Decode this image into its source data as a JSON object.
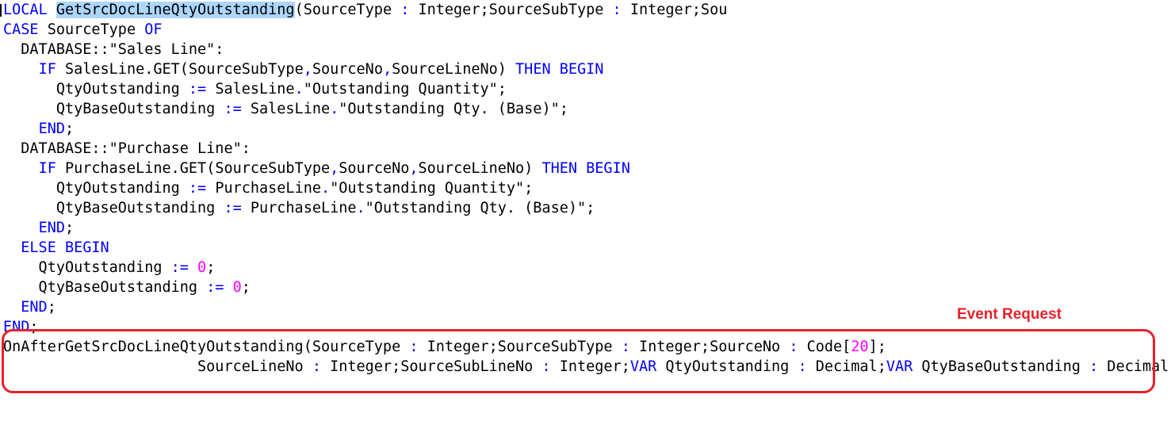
{
  "editor": {
    "lines": [
      {
        "segments": [
          {
            "text": "LOCAL ",
            "cls": "kw"
          },
          {
            "text": "GetSrcDocLineQtyOutstanding",
            "cls": "ident hl"
          },
          {
            "text": "(SourceType ",
            "cls": "ident"
          },
          {
            "text": ":",
            "cls": "op"
          },
          {
            "text": " Integer;SourceSubType ",
            "cls": "ident"
          },
          {
            "text": ":",
            "cls": "op"
          },
          {
            "text": " Integer;Sou",
            "cls": "ident"
          }
        ]
      },
      {
        "segments": [
          {
            "text": "CASE ",
            "cls": "kw"
          },
          {
            "text": "SourceType ",
            "cls": "ident"
          },
          {
            "text": "OF",
            "cls": "kw"
          }
        ]
      },
      {
        "segments": [
          {
            "text": "  DATABASE::\"Sales Line\":",
            "cls": "ident"
          }
        ]
      },
      {
        "segments": [
          {
            "text": "    ",
            "cls": "ident"
          },
          {
            "text": "IF ",
            "cls": "kw"
          },
          {
            "text": "SalesLine.GET(SourceSubType",
            "cls": "ident"
          },
          {
            "text": ",",
            "cls": "op"
          },
          {
            "text": "SourceNo",
            "cls": "ident"
          },
          {
            "text": ",",
            "cls": "op"
          },
          {
            "text": "SourceLineNo) ",
            "cls": "ident"
          },
          {
            "text": "THEN BEGIN",
            "cls": "kw"
          }
        ]
      },
      {
        "segments": [
          {
            "text": "      QtyOutstanding ",
            "cls": "ident"
          },
          {
            "text": ":=",
            "cls": "op"
          },
          {
            "text": " SalesLine",
            "cls": "ident"
          },
          {
            "text": ".",
            "cls": "op"
          },
          {
            "text": "\"Outstanding Quantity\";",
            "cls": "ident"
          }
        ]
      },
      {
        "segments": [
          {
            "text": "      QtyBaseOutstanding ",
            "cls": "ident"
          },
          {
            "text": ":=",
            "cls": "op"
          },
          {
            "text": " SalesLine",
            "cls": "ident"
          },
          {
            "text": ".",
            "cls": "op"
          },
          {
            "text": "\"Outstanding Qty. (Base)\";",
            "cls": "ident"
          }
        ]
      },
      {
        "segments": [
          {
            "text": "    ",
            "cls": "ident"
          },
          {
            "text": "END",
            "cls": "kw"
          },
          {
            "text": ";",
            "cls": "ident"
          }
        ]
      },
      {
        "segments": [
          {
            "text": "  DATABASE::\"Purchase Line\":",
            "cls": "ident"
          }
        ]
      },
      {
        "segments": [
          {
            "text": "    ",
            "cls": "ident"
          },
          {
            "text": "IF ",
            "cls": "kw"
          },
          {
            "text": "PurchaseLine.GET(SourceSubType",
            "cls": "ident"
          },
          {
            "text": ",",
            "cls": "op"
          },
          {
            "text": "SourceNo",
            "cls": "ident"
          },
          {
            "text": ",",
            "cls": "op"
          },
          {
            "text": "SourceLineNo) ",
            "cls": "ident"
          },
          {
            "text": "THEN BEGIN",
            "cls": "kw"
          }
        ]
      },
      {
        "segments": [
          {
            "text": "      QtyOutstanding ",
            "cls": "ident"
          },
          {
            "text": ":=",
            "cls": "op"
          },
          {
            "text": " PurchaseLine",
            "cls": "ident"
          },
          {
            "text": ".",
            "cls": "op"
          },
          {
            "text": "\"Outstanding Quantity\";",
            "cls": "ident"
          }
        ]
      },
      {
        "segments": [
          {
            "text": "      QtyBaseOutstanding ",
            "cls": "ident"
          },
          {
            "text": ":=",
            "cls": "op"
          },
          {
            "text": " PurchaseLine",
            "cls": "ident"
          },
          {
            "text": ".",
            "cls": "op"
          },
          {
            "text": "\"Outstanding Qty. (Base)\";",
            "cls": "ident"
          }
        ]
      },
      {
        "segments": [
          {
            "text": "    ",
            "cls": "ident"
          },
          {
            "text": "END",
            "cls": "kw"
          },
          {
            "text": ";",
            "cls": "ident"
          }
        ]
      },
      {
        "segments": [
          {
            "text": "  ",
            "cls": "ident"
          },
          {
            "text": "ELSE BEGIN",
            "cls": "kw"
          }
        ]
      },
      {
        "segments": [
          {
            "text": "    QtyOutstanding ",
            "cls": "ident"
          },
          {
            "text": ":=",
            "cls": "op"
          },
          {
            "text": " ",
            "cls": "ident"
          },
          {
            "text": "0",
            "cls": "num"
          },
          {
            "text": ";",
            "cls": "ident"
          }
        ]
      },
      {
        "segments": [
          {
            "text": "    QtyBaseOutstanding ",
            "cls": "ident"
          },
          {
            "text": ":=",
            "cls": "op"
          },
          {
            "text": " ",
            "cls": "ident"
          },
          {
            "text": "0",
            "cls": "num"
          },
          {
            "text": ";",
            "cls": "ident"
          }
        ]
      },
      {
        "segments": [
          {
            "text": "  ",
            "cls": "ident"
          },
          {
            "text": "END",
            "cls": "kw"
          },
          {
            "text": ";",
            "cls": "ident"
          }
        ]
      },
      {
        "segments": [
          {
            "text": "END",
            "cls": "kw"
          },
          {
            "text": ";",
            "cls": "ident"
          }
        ]
      },
      {
        "segments": [
          {
            "text": "OnAfterGetSrcDocLineQtyOutstanding(SourceType ",
            "cls": "ident"
          },
          {
            "text": ":",
            "cls": "op"
          },
          {
            "text": " Integer;SourceSubType ",
            "cls": "ident"
          },
          {
            "text": ":",
            "cls": "op"
          },
          {
            "text": " Integer;SourceNo ",
            "cls": "ident"
          },
          {
            "text": ":",
            "cls": "op"
          },
          {
            "text": " Code[",
            "cls": "ident"
          },
          {
            "text": "20",
            "cls": "num"
          },
          {
            "text": "];",
            "cls": "ident"
          }
        ]
      },
      {
        "segments": [
          {
            "text": "                      SourceLineNo ",
            "cls": "ident"
          },
          {
            "text": ":",
            "cls": "op"
          },
          {
            "text": " Integer;SourceSubLineNo ",
            "cls": "ident"
          },
          {
            "text": ":",
            "cls": "op"
          },
          {
            "text": " Integer;",
            "cls": "ident"
          },
          {
            "text": "VAR",
            "cls": "kw"
          },
          {
            "text": " QtyOutstanding ",
            "cls": "ident"
          },
          {
            "text": ":",
            "cls": "op"
          },
          {
            "text": " Decimal;",
            "cls": "ident"
          },
          {
            "text": "VAR",
            "cls": "kw"
          },
          {
            "text": " QtyBaseOutstanding ",
            "cls": "ident"
          },
          {
            "text": ":",
            "cls": "op"
          },
          {
            "text": " Decimal)",
            "cls": "ident"
          }
        ]
      }
    ]
  },
  "annotation": {
    "label": "Event Request",
    "color": "#e8202a"
  },
  "colors": {
    "keyword": "#0000ff",
    "number": "#ff00ff",
    "highlight": "#add6ff",
    "text": "#000000"
  }
}
